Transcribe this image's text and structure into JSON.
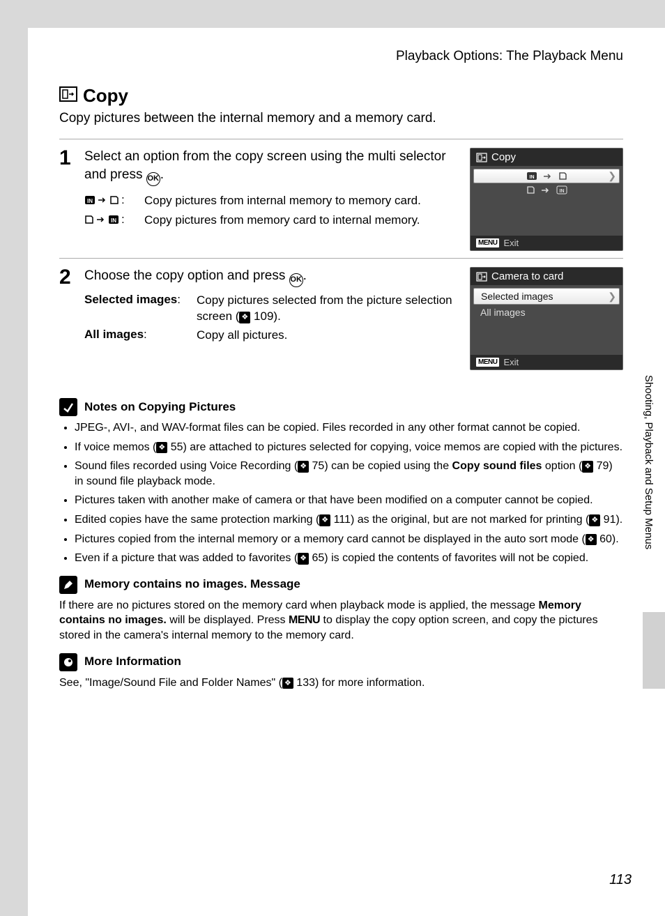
{
  "header": {
    "title": "Playback Options: The Playback Menu"
  },
  "main": {
    "heading": "Copy",
    "intro": "Copy pictures between the internal memory and a memory card."
  },
  "steps": [
    {
      "num": "1",
      "text_a": "Select an option from the copy screen using the multi selector and press ",
      "text_b": ".",
      "directions": [
        {
          "desc": "Copy pictures from internal memory to memory card."
        },
        {
          "desc": "Copy pictures from memory card to internal memory."
        }
      ],
      "screen": {
        "title": "Copy",
        "footer": "Exit"
      }
    },
    {
      "num": "2",
      "text_a": "Choose the copy option and press ",
      "text_b": ".",
      "defs": [
        {
          "term": "Selected images",
          "desc_a": "Copy pictures selected from the picture selection screen (",
          "desc_ref": "109",
          "desc_b": ")."
        },
        {
          "term": "All images",
          "desc_a": "Copy all pictures.",
          "desc_ref": "",
          "desc_b": ""
        }
      ],
      "screen": {
        "title": "Camera to card",
        "opt1": "Selected images",
        "opt2": "All images",
        "footer": "Exit"
      }
    }
  ],
  "notes": {
    "heading": "Notes on Copying Pictures",
    "b1a": "JPEG-, AVI-, and WAV-format files can be copied. Files recorded in any other format cannot be copied.",
    "b2a": "If voice memos (",
    "b2ref": "55",
    "b2b": ") are attached to pictures selected for copying, voice memos are copied with the pictures.",
    "b3a": "Sound files recorded using Voice Recording (",
    "b3ref": "75",
    "b3b": ") can be copied using the ",
    "b3bold": "Copy sound files",
    "b3c": " option (",
    "b3ref2": "79",
    "b3d": ") in sound file playback mode.",
    "b4a": "Pictures taken with another make of camera or that have been modified on a computer cannot be copied.",
    "b5a": "Edited copies have the same protection marking (",
    "b5ref": "111",
    "b5b": ") as the original, but are not marked for printing (",
    "b5ref2": "91",
    "b5c": ").",
    "b6a": "Pictures copied from the internal memory or a memory card cannot be displayed in the auto sort mode (",
    "b6ref": "60",
    "b6b": ").",
    "b7a": "Even if a picture that was added to favorites (",
    "b7ref": "65",
    "b7b": ") is copied the contents of favorites will not be copied."
  },
  "mem_note": {
    "heading": "Memory contains no images. Message",
    "p1": "If there are no pictures stored on the memory card when playback mode is applied, the message ",
    "bold": "Memory contains no images.",
    "p2": " will be displayed. Press ",
    "menu": "MENU",
    "p3": " to display the copy option screen, and copy the pictures stored in the camera's internal memory to the memory card."
  },
  "more_info": {
    "heading": "More Information",
    "p1": "See, \"Image/Sound File and Folder Names\" (",
    "ref": "133",
    "p2": ") for more information."
  },
  "side_tab": "Shooting, Playback and Setup Menus",
  "page_number": "113",
  "labels": {
    "ok": "OK",
    "menu": "MENU"
  }
}
